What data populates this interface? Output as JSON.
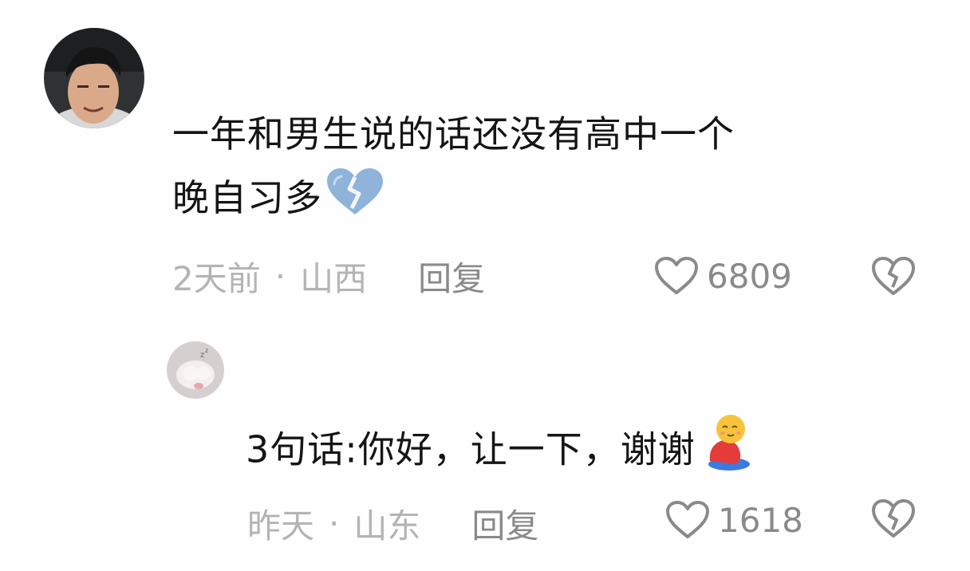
{
  "comments": [
    {
      "text_line1": "一年和男生说的话还没有高中一个",
      "text_line2": "晚自习多",
      "emoji": "broken-heart-icon",
      "time": "2天前",
      "separator": "·",
      "location": "山西",
      "reply_label": "回复",
      "likes": "6809"
    },
    {
      "text": "3句话:你好，让一下，谢谢",
      "emoji": "bowing-person-icon",
      "time": "昨天",
      "separator": "·",
      "location": "山东",
      "reply_label": "回复",
      "likes": "1618"
    }
  ],
  "colors": {
    "text": "#151515",
    "meta": "#b4b4b4",
    "secondary": "#8a8a8a",
    "broken_heart": "#8fb3d9"
  }
}
